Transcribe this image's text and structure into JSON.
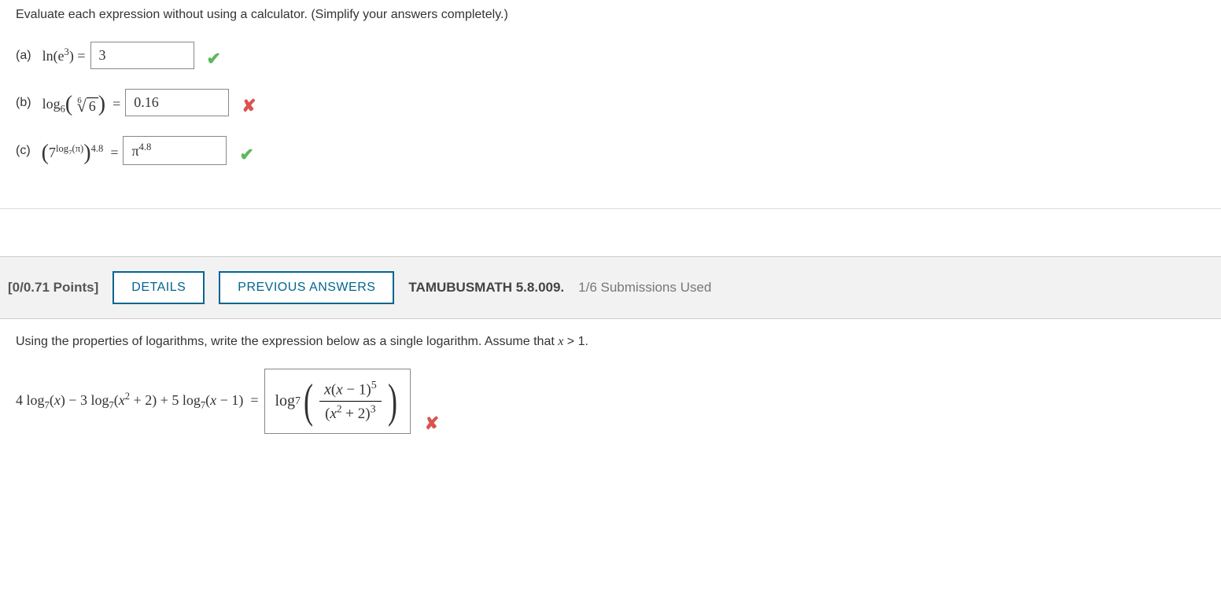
{
  "q1": {
    "instruction": "Evaluate each expression without using a calculator. (Simplify your answers completely.)",
    "parts": {
      "a": {
        "label": "(a)",
        "expr_prefix": "ln(e",
        "exp": "3",
        "expr_suffix": ")  =",
        "answer": "3",
        "mark": "correct"
      },
      "b": {
        "label": "(b)",
        "base": "6",
        "root_index": "6",
        "radicand": "6",
        "answer": "0.16",
        "mark": "incorrect"
      },
      "c": {
        "label": "(c)",
        "base": "7",
        "log_sub": "7",
        "pi": "π",
        "outer_exp": "4.8",
        "answer_pi": "π",
        "answer_exp": "4.8",
        "mark": "correct"
      }
    }
  },
  "q2header": {
    "points": "[0/0.71 Points]",
    "details_label": "DETAILS",
    "previous_label": "PREVIOUS ANSWERS",
    "ref": "TAMUBUSMATH 5.8.009.",
    "submissions": "1/6 Submissions Used"
  },
  "q2": {
    "instruction": "Using the properties of logarithms, write the expression below as a single logarithm. Assume that x > 1.",
    "lhs": "4 log₇(x) − 3 log₇(x² + 2) + 5 log₇(x − 1)  =",
    "answer": {
      "log_label": "log",
      "log_base": "7",
      "num_x": "x",
      "num_paren": "(x − 1)",
      "num_exp": "5",
      "den_paren": "(x² + 2)",
      "den_exp": "3"
    },
    "mark": "incorrect"
  },
  "glyphs": {
    "check": "✔",
    "cross": "✘"
  }
}
